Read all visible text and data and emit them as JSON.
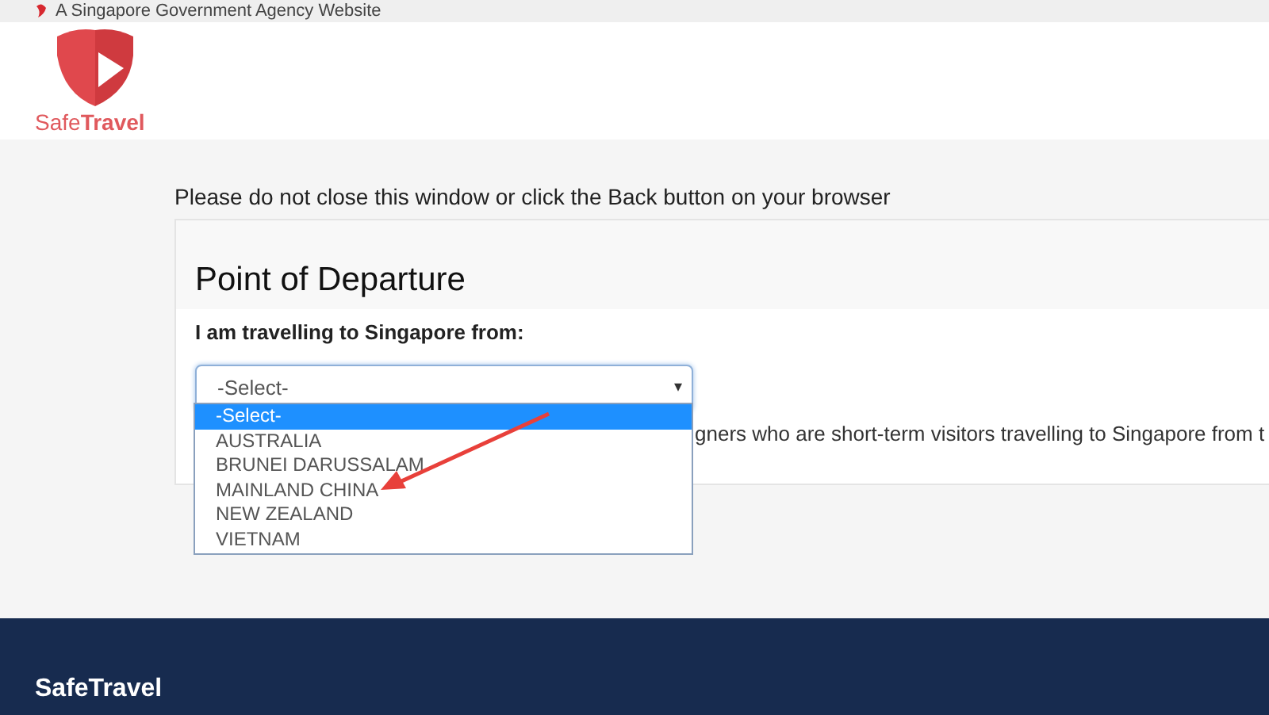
{
  "gov_banner": {
    "text": "A Singapore Government Agency Website"
  },
  "header": {
    "logo_text": "Safe**Travel**"
  },
  "notice": "Please do not close this window or click the Back button on your browser",
  "card": {
    "title": "Point of Departure",
    "label": "I am travelling to Singapore from:",
    "select": {
      "value": "-Select-",
      "caret": "▾",
      "options": [
        {
          "label": "-Select-",
          "selected": true
        },
        {
          "label": "AUSTRALIA",
          "selected": false
        },
        {
          "label": "BRUNEI DARUSSALAM",
          "selected": false
        },
        {
          "label": "MAINLAND CHINA",
          "selected": false
        },
        {
          "label": "NEW ZEALAND",
          "selected": false
        },
        {
          "label": "VIETNAM",
          "selected": false
        }
      ]
    },
    "info_text": "gners who are short-term visitors travelling to Singapore from t"
  },
  "footer": {
    "brand": "SafeTravel"
  }
}
